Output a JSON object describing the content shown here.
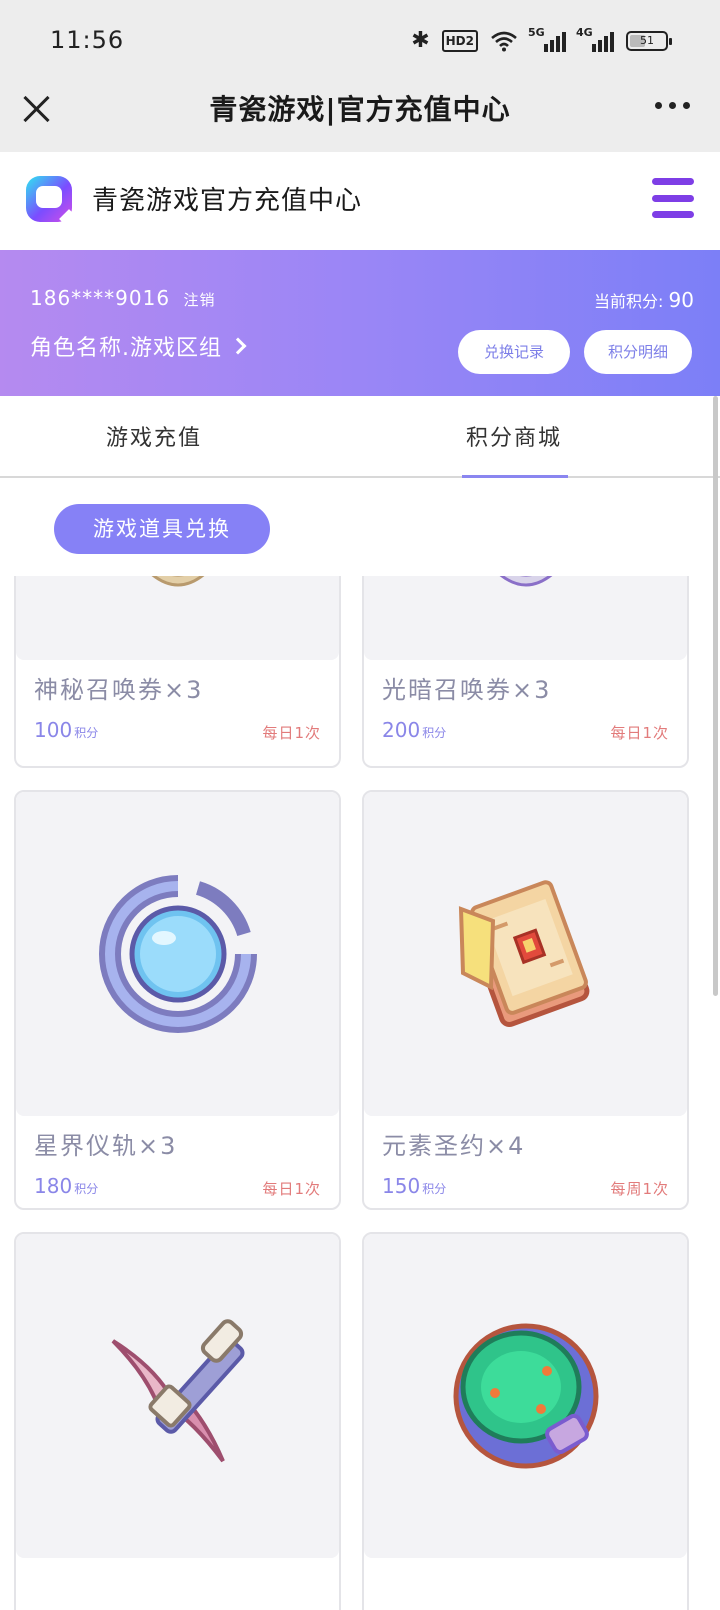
{
  "status_bar": {
    "time": "11:56",
    "hd_label": "HD2",
    "sig1_label": "5G",
    "sig2_label": "4G",
    "battery": "51"
  },
  "title_bar": {
    "title": "青瓷游戏|官方充值中心"
  },
  "site_header": {
    "title": "青瓷游戏官方充值中心"
  },
  "account": {
    "phone": "186****9016",
    "logout_label": "注销",
    "role_label": "角色名称.游戏区组",
    "points_label": "当前积分:",
    "points_value": "90",
    "history_button": "兑换记录",
    "detail_button": "积分明细"
  },
  "tabs": [
    {
      "label": "游戏充值",
      "active": false
    },
    {
      "label": "积分商城",
      "active": true
    }
  ],
  "category": {
    "label": "游戏道具兑换"
  },
  "products": [
    {
      "name": "神秘召唤券×3",
      "price": "100",
      "unit": "积分",
      "limit": "每日1次",
      "icon": "mystery-summon-ticket-icon"
    },
    {
      "name": "光暗召唤券×3",
      "price": "200",
      "unit": "积分",
      "limit": "每日1次",
      "icon": "light-dark-summon-ticket-icon"
    },
    {
      "name": "星界仪轨×3",
      "price": "180",
      "unit": "积分",
      "limit": "每日1次",
      "icon": "astral-orb-icon"
    },
    {
      "name": "元素圣约×4",
      "price": "150",
      "unit": "积分",
      "limit": "每周1次",
      "icon": "elemental-book-icon"
    },
    {
      "name": "",
      "price": "",
      "unit": "",
      "limit": "",
      "icon": "pickaxe-icon"
    },
    {
      "name": "",
      "price": "",
      "unit": "",
      "limit": "",
      "icon": "green-gem-badge-icon"
    }
  ],
  "colors": {
    "accent": "#8681f6",
    "banner_start": "#b58af0",
    "banner_end": "#7c7ff7",
    "menu_icon": "#7e3ee6",
    "limit_text": "#e27b7b"
  }
}
